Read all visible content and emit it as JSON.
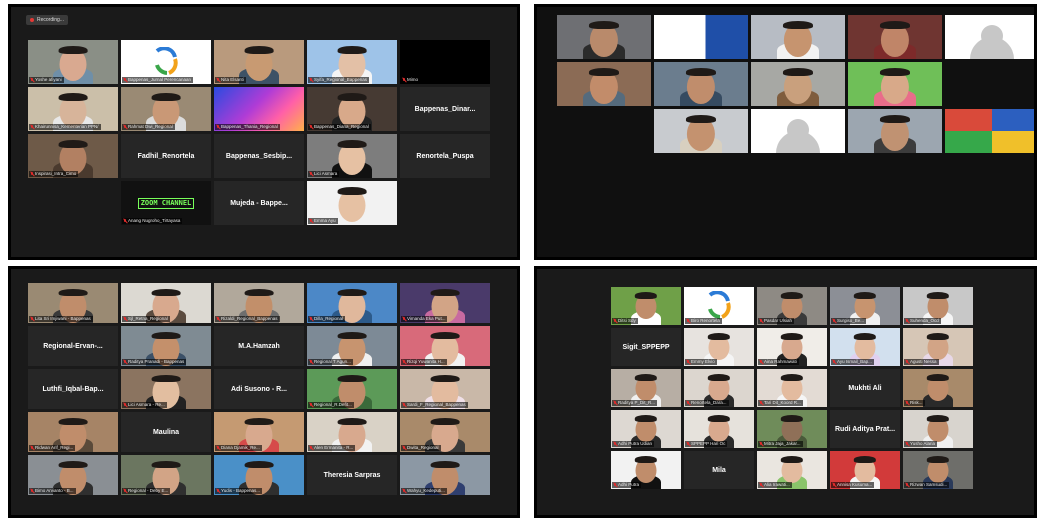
{
  "recording": {
    "label": "Recording..."
  },
  "colors": {
    "active_speaker": "#c8e04a",
    "muted": "#e02b2b",
    "recording": "#e53935"
  },
  "panel1": {
    "tiles": [
      {
        "caption": "Yoshe afiyani",
        "kind": "photo",
        "bg": "#8a8f86",
        "skin": "#d9a990",
        "shirt": "#6f8fa8",
        "active": true
      },
      {
        "caption": "Bappenas_Jurnal Perencanaan",
        "kind": "logo",
        "bg": "#ffffff"
      },
      {
        "caption": "Nita Elsanti",
        "kind": "photo",
        "bg": "#b99a7d",
        "skin": "#c89a72",
        "shirt": "#3d5266"
      },
      {
        "caption": "Syifa_Regional_Bappenas",
        "kind": "photo",
        "bg": "#9ec3e8",
        "skin": "#e3c0a6",
        "shirt": "#f5f5f5"
      },
      {
        "caption": "Mimo",
        "kind": "blank"
      },
      {
        "caption": "Khairunnisa_Kementerian PPN/",
        "kind": "photo",
        "bg": "#cbbfa9",
        "skin": "#d7b49a",
        "shirt": "#e8e8e8"
      },
      {
        "caption": "Rahmat Dwi_Regional",
        "kind": "photo",
        "bg": "#9a8a74",
        "skin": "#c99876",
        "shirt": "#dcdcdc"
      },
      {
        "caption": "Bappenas_Thania_Regional",
        "kind": "art",
        "bg": "#7a3fd1"
      },
      {
        "caption": "Bappenas_Diana_Regional",
        "kind": "photo",
        "bg": "#463a33",
        "skin": "#d8a98a",
        "shirt": "#222222"
      },
      {
        "caption": "",
        "kind": "name",
        "name": "Bappenas_Dinar..."
      },
      {
        "caption": "Inspirasi_Intra_Cimo",
        "kind": "photo",
        "bg": "#6e5a48",
        "skin": "#b28062",
        "shirt": "#4a3a2e"
      },
      {
        "caption": "",
        "kind": "name",
        "name": "Fadhil_Renortela"
      },
      {
        "caption": "",
        "kind": "name",
        "name": "Bappenas_Sesbip..."
      },
      {
        "caption": "Lici Asmara",
        "kind": "photo",
        "bg": "#7d7d7d",
        "skin": "#e6c1a3",
        "shirt": "#111111"
      },
      {
        "caption": "",
        "kind": "name",
        "name": "Renortela_Puspa"
      },
      {
        "caption": "",
        "kind": "empty"
      },
      {
        "caption": "Anang Nugroho_Tirtayasa",
        "kind": "zoom",
        "bg": "#111111",
        "text": "ZOOM CHANNEL"
      },
      {
        "caption": "",
        "kind": "name",
        "name": "Mujeda - Bappe..."
      },
      {
        "caption": "Emma Ayu",
        "kind": "photo",
        "bg": "#f2f2f2",
        "skin": "#e6c1a3",
        "shirt": "#f2f2f2"
      },
      {
        "caption": "",
        "kind": "empty"
      }
    ]
  },
  "panel2": {
    "tiles": [
      {
        "kind": "photo",
        "bg": "#6e6f73",
        "skin": "#b98a6b",
        "shirt": "#2b2b2b"
      },
      {
        "kind": "doc",
        "bg": "#ffffff"
      },
      {
        "kind": "photo",
        "bg": "#b7bcc4",
        "skin": "#c6946f",
        "shirt": "#f2f2f2"
      },
      {
        "kind": "photo",
        "bg": "#6f3531",
        "skin": "#c08568",
        "shirt": "#7d2a2a"
      },
      {
        "kind": "avatar"
      },
      {
        "kind": "photo",
        "bg": "#8b6b55",
        "skin": "#c28c6a",
        "shirt": "#556b7d"
      },
      {
        "kind": "photo",
        "bg": "#6b7d8e",
        "skin": "#c08d6c",
        "shirt": "#364b61"
      },
      {
        "kind": "photo",
        "bg": "#a7a8a4",
        "skin": "#c9a07d",
        "shirt": "#7f5d3e"
      },
      {
        "kind": "photo",
        "bg": "#6fbf58",
        "skin": "#d8a989",
        "shirt": "#e86d8a"
      },
      {
        "kind": "empty"
      },
      {
        "kind": "empty"
      },
      {
        "kind": "photo",
        "bg": "#c8cbcf",
        "skin": "#c4926f",
        "shirt": "#d8d0c0"
      },
      {
        "kind": "avatar"
      },
      {
        "kind": "photo",
        "bg": "#9ca6b0",
        "skin": "#c09272",
        "shirt": "#3c3c3c"
      },
      {
        "kind": "mosaic",
        "bg": "#3a5aa8"
      }
    ]
  },
  "panel3": {
    "tiles": [
      {
        "caption": "Lita Sri Imjiwani - Bappenas",
        "kind": "photo",
        "bg": "#9a8a73",
        "skin": "#c08d6b",
        "shirt": "#3a3a3a"
      },
      {
        "caption": "Sjl_Retna_Regional",
        "kind": "photo",
        "bg": "#dcd9d2",
        "skin": "#d8a98e",
        "shirt": "#5b4b3f"
      },
      {
        "caption": "Rizaldi_Regional_Bappenas",
        "kind": "photo",
        "bg": "#b1a89b",
        "skin": "#c28f6a",
        "shirt": "#6e6e6e"
      },
      {
        "caption": "Dilla_Regional",
        "kind": "photo",
        "bg": "#4c88c7",
        "skin": "#e0b89c",
        "shirt": "#2c5a8a"
      },
      {
        "caption": "Vimanda Eka Put...",
        "kind": "photo",
        "bg": "#4a3a6a",
        "skin": "#d2a486",
        "shirt": "#c86aa0"
      },
      {
        "caption": "",
        "kind": "name",
        "name": "Regional-Ervan-..."
      },
      {
        "caption": "Raditya Pranadi - Bappenas",
        "kind": "photo",
        "bg": "#7f8b93",
        "skin": "#c4906b",
        "shirt": "#3b5067"
      },
      {
        "caption": "",
        "kind": "name",
        "name": "M.A.Hamzah"
      },
      {
        "caption": "Regional T Agun...",
        "kind": "photo",
        "bg": "#7d8a96",
        "skin": "#c7946f",
        "shirt": "#f0f0f0"
      },
      {
        "caption": "Rizqi Yuwanita H...",
        "kind": "photo",
        "bg": "#d86a7a",
        "skin": "#e3bb9f",
        "shirt": "#f2f2f2"
      },
      {
        "caption": "",
        "kind": "name",
        "name": "Luthfi_Iqbal-Bap..."
      },
      {
        "caption": "Lici Asmara - Re...",
        "kind": "photo",
        "bg": "#8b7460",
        "skin": "#e2bea0",
        "shirt": "#222222"
      },
      {
        "caption": "",
        "kind": "name",
        "name": "Adi Susono - R..."
      },
      {
        "caption": "Regional_R.Defit...",
        "kind": "photo",
        "bg": "#5c9a58",
        "skin": "#c08d6b",
        "shirt": "#3a6a3a"
      },
      {
        "caption": "Sardi_F_Regional_Bappenas",
        "kind": "photo",
        "bg": "#c9b8a8",
        "skin": "#e3bb9f",
        "shirt": "#f0e0e8"
      },
      {
        "caption": "Ridwan Arif_Regi...",
        "kind": "photo",
        "bg": "#a68466",
        "skin": "#c08d6b",
        "shirt": "#5a4a3a"
      },
      {
        "caption": "",
        "kind": "name",
        "name": "Maulina"
      },
      {
        "caption": "Diana Djamik_Re...",
        "kind": "photo",
        "bg": "#c59a72",
        "skin": "#d8a98e",
        "shirt": "#d64a4a"
      },
      {
        "caption": "Alen Ermanita - R...",
        "kind": "photo",
        "bg": "#d9d2c6",
        "skin": "#d8a98e",
        "shirt": "#f2f2f2"
      },
      {
        "caption": "Dwita_Regional",
        "kind": "photo",
        "bg": "#a98a6a",
        "skin": "#d8a98e",
        "shirt": "#3a3a3a"
      },
      {
        "caption": "Bimo Arvianto - B...",
        "kind": "photo",
        "bg": "#8a8f94",
        "skin": "#c08d6b",
        "shirt": "#2f2f2f"
      },
      {
        "caption": "Regional - Deby E...",
        "kind": "photo",
        "bg": "#6b7660",
        "skin": "#d2a486",
        "shirt": "#2f2f2f"
      },
      {
        "caption": "Yudis - Bappenas...",
        "kind": "photo",
        "bg": "#4a90c8",
        "skin": "#c08d6b",
        "shirt": "#2f2f2f"
      },
      {
        "caption": "",
        "kind": "name",
        "name": "Theresia Sarpras"
      },
      {
        "caption": "Wahyu_Kedeputi...",
        "kind": "photo",
        "bg": "#8c98a4",
        "skin": "#c08d6b",
        "shirt": "#2f3f6f"
      }
    ]
  },
  "panel4": {
    "tiles": [
      {
        "caption": "Ditsi Sdy",
        "kind": "photo",
        "bg": "#6fa048",
        "skin": "#c08d6b",
        "shirt": "#ffffff"
      },
      {
        "caption": "Biro Renortela",
        "kind": "logo",
        "bg": "#ffffff"
      },
      {
        "caption": "Pasdar Ulsiah",
        "kind": "photo",
        "bg": "#8e8a84",
        "skin": "#c08d6b",
        "shirt": "#3a3a3a"
      },
      {
        "caption": "Surgiso_Be...",
        "kind": "photo",
        "bg": "#8c8f96",
        "skin": "#c7946f",
        "shirt": "#f0f0f0"
      },
      {
        "caption": "Suhenda_Ocd",
        "kind": "photo",
        "bg": "#c8c8c8",
        "skin": "#c08d6b",
        "shirt": "#f5f5f5"
      },
      {
        "caption": "",
        "kind": "name",
        "name": "Sigit_SPPEPP"
      },
      {
        "caption": "Emmy Elvio",
        "kind": "photo",
        "bg": "#e7e3df",
        "skin": "#e3bb9f",
        "shirt": "#f5f5f5"
      },
      {
        "caption": "Aina Rahmawati",
        "kind": "photo",
        "bg": "#f0ede8",
        "skin": "#d8a98e",
        "shirt": "#222222"
      },
      {
        "caption": "Ayu Ismail_Bap...",
        "kind": "photo",
        "bg": "#d2e0ee",
        "skin": "#e3bb9f",
        "shirt": "#e0d0f0"
      },
      {
        "caption": "Agusti Nessa",
        "kind": "photo",
        "bg": "#d6c6b6",
        "skin": "#d2a486",
        "shirt": "#e8d8e8"
      },
      {
        "caption": "Raditya P_Dit_R...",
        "kind": "photo",
        "bg": "#b7aea4",
        "skin": "#c08d6b",
        "shirt": "#f0f0f0"
      },
      {
        "caption": "Renortela_Dara...",
        "kind": "photo",
        "bg": "#dcd6cf",
        "skin": "#d8a98e",
        "shirt": "#2a2a2a"
      },
      {
        "caption": "Tari Dit_Koord R...",
        "kind": "photo",
        "bg": "#e3dbd4",
        "skin": "#e3bb9f",
        "shirt": "#f5f5f5"
      },
      {
        "caption": "",
        "kind": "name",
        "name": "Mukhti Ali"
      },
      {
        "caption": "Risk...",
        "kind": "photo",
        "bg": "#a88a6a",
        "skin": "#c08d6b",
        "shirt": "#2a2a2a"
      },
      {
        "caption": "Adhi Putra Udian",
        "kind": "photo",
        "bg": "#ddd8d2",
        "skin": "#c08d6b",
        "shirt": "#2a2a2a"
      },
      {
        "caption": "SPPEPP Hari Oc",
        "kind": "photo",
        "bg": "#e6e2dc",
        "skin": "#d8a98e",
        "shirt": "#2a2a2a"
      },
      {
        "caption": "Mitra Jaja_Jakar...",
        "kind": "photo",
        "bg": "#6f8c5a",
        "skin": "#8f7058",
        "shirt": "#4a5a3a"
      },
      {
        "caption": "",
        "kind": "name",
        "name": "Rudi Aditya Prat..."
      },
      {
        "caption": "Yusho Alaria",
        "kind": "photo",
        "bg": "#d8d4ce",
        "skin": "#c08d6b",
        "shirt": "#f0f0f0"
      },
      {
        "caption": "Adhi Putra",
        "kind": "photo",
        "bg": "#f2f2f2",
        "skin": "#c08d6b",
        "shirt": "#111111"
      },
      {
        "caption": "",
        "kind": "name",
        "name": "Mila"
      },
      {
        "caption": "Alia Irawati...",
        "kind": "photo",
        "bg": "#eae6e0",
        "skin": "#e3bb9f",
        "shirt": "#8ac46a"
      },
      {
        "caption": "Annisa Kusuma...",
        "kind": "photo",
        "bg": "#d23a3a",
        "skin": "#e3bb9f",
        "shirt": "#f5f5f5"
      },
      {
        "caption": "Rizwan Samsudi...",
        "kind": "photo",
        "bg": "#6e6e6a",
        "skin": "#c08d6b",
        "shirt": "#2a3a5a",
        "active": true
      }
    ]
  }
}
